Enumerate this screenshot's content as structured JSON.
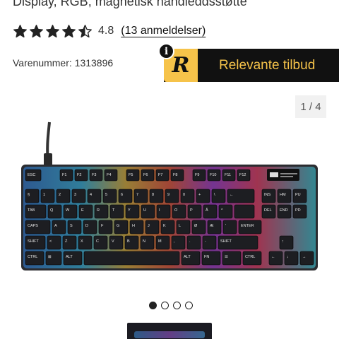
{
  "product": {
    "subtitle": "Display, RGB, magnetisk håndleddsstøtte",
    "rating_value": "4.8",
    "rating_stars": 4.5,
    "reviews_label": "(13 anmeldelser)",
    "sku_label": "Varenummer: 1313896"
  },
  "offer": {
    "logo_letter": "R",
    "label": "Relevante tilbud",
    "info_glyph": "i",
    "colors": {
      "background": "#111111",
      "accent": "#f6c34a"
    }
  },
  "gallery": {
    "counter": "1 / 4",
    "dots": [
      true,
      false,
      false,
      false
    ]
  },
  "keyboard": {
    "rows": [
      [
        "ESC",
        "F1",
        "F2",
        "F3",
        "F4",
        "F5",
        "F6",
        "F7",
        "F8",
        "F9",
        "F10",
        "F11",
        "F12"
      ],
      [
        "§",
        "1",
        "2",
        "3",
        "4",
        "5",
        "6",
        "7",
        "8",
        "9",
        "0",
        "+",
        "\\",
        "←",
        "INS",
        "HM",
        "PU"
      ],
      [
        "TAB",
        "Q",
        "W",
        "E",
        "R",
        "T",
        "Y",
        "U",
        "I",
        "O",
        "P",
        "Å",
        "^",
        "",
        "DEL",
        "END",
        "PD"
      ],
      [
        "CAPS",
        "A",
        "S",
        "D",
        "F",
        "G",
        "H",
        "J",
        "K",
        "L",
        "Ø",
        "Æ",
        "'",
        "ENTER"
      ],
      [
        "SHIFT",
        "<",
        "Z",
        "X",
        "C",
        "V",
        "B",
        "N",
        "M",
        ",",
        ".",
        "-",
        "SHIFT",
        "↑"
      ],
      [
        "CTRL",
        "⊞",
        "ALT",
        "",
        "ALT",
        "FN",
        "☰",
        "CTRL",
        "←",
        "↓",
        "→"
      ]
    ]
  }
}
